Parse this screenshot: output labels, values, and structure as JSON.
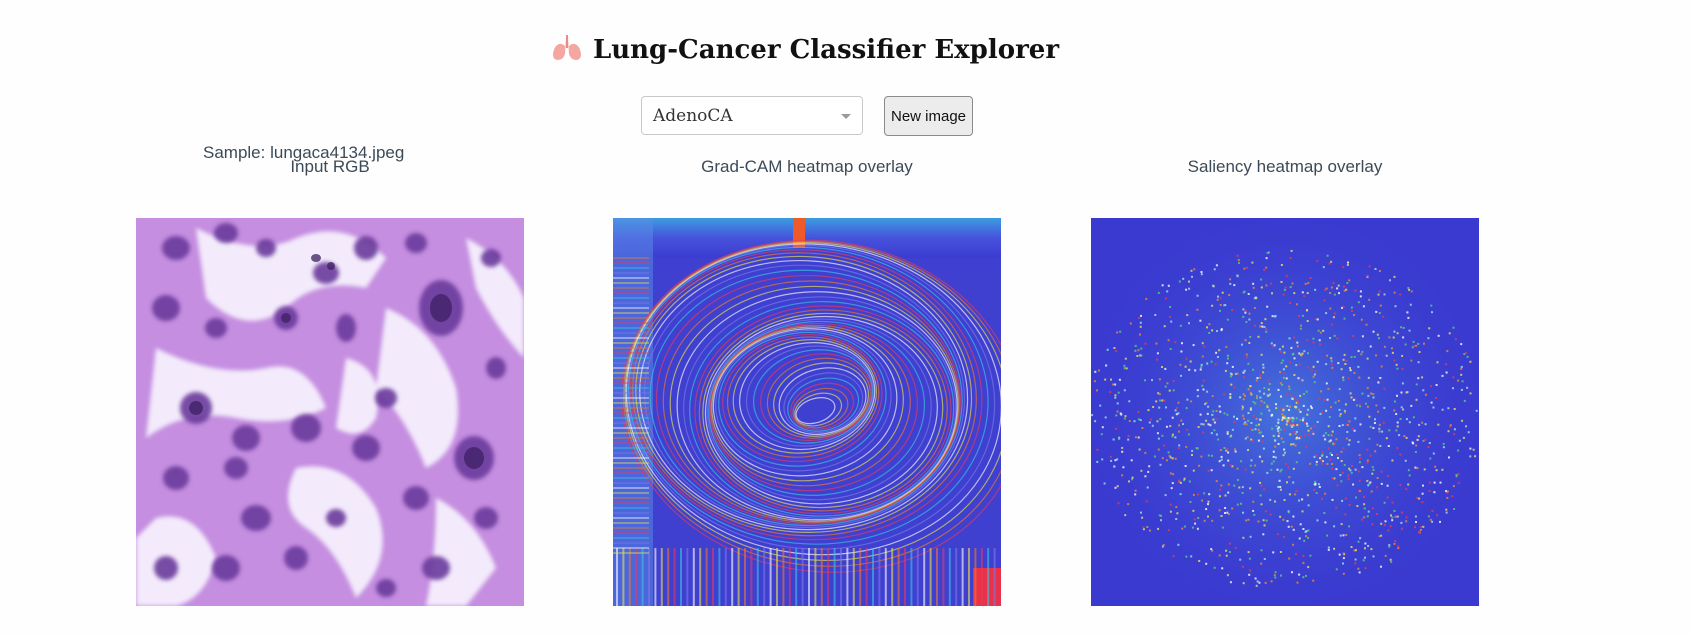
{
  "header": {
    "title": "Lung-Cancer Classifier Explorer",
    "title_icon": "lungs-icon"
  },
  "controls": {
    "class_select_value": "AdenoCA",
    "new_image_label": "New image"
  },
  "sample_label": "Sample: lungaca4134.jpeg",
  "panels": [
    {
      "title": "Input RGB"
    },
    {
      "title": "Grad-CAM heatmap overlay"
    },
    {
      "title": "Saliency heatmap overlay"
    }
  ],
  "colors": {
    "text_muted": "#3c4a57",
    "tissue_pink": "#c58ee0",
    "nucleus_purple": "#6a3a9c",
    "heatmap_blue": "#3a3ad0"
  }
}
